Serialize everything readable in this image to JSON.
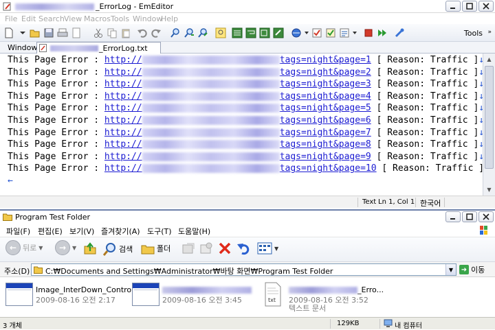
{
  "editor": {
    "title_suffix": "_ErrorLog - EmEditor",
    "menu": [
      "File",
      "Edit",
      "Search",
      "View",
      "Macros",
      "Tools",
      "Window",
      "Help"
    ],
    "tools_label": "Tools",
    "windows_label": "Windows",
    "tab_label": "_ErrorLog.txt",
    "lines": [
      {
        "prefix": "This Page Error : ",
        "url_start": "http://",
        "url_end": "tags=night&page=1",
        "suffix": " [ Reason: Traffic ]",
        "eol": "↓"
      },
      {
        "prefix": "This Page Error : ",
        "url_start": "http://",
        "url_end": "tags=night&page=2",
        "suffix": " [ Reason: Traffic ]",
        "eol": "↓"
      },
      {
        "prefix": "This Page Error : ",
        "url_start": "http://",
        "url_end": "tags=night&page=3",
        "suffix": " [ Reason: Traffic ]",
        "eol": "↓"
      },
      {
        "prefix": "This Page Error : ",
        "url_start": "http://",
        "url_end": "tags=night&page=4",
        "suffix": " [ Reason: Traffic ]",
        "eol": "↓"
      },
      {
        "prefix": "This Page Error : ",
        "url_start": "http://",
        "url_end": "tags=night&page=5",
        "suffix": " [ Reason: Traffic ]",
        "eol": "↓"
      },
      {
        "prefix": "This Page Error : ",
        "url_start": "http://",
        "url_end": "tags=night&page=6",
        "suffix": " [ Reason: Traffic ]",
        "eol": "↓"
      },
      {
        "prefix": "This Page Error : ",
        "url_start": "http://",
        "url_end": "tags=night&page=7",
        "suffix": " [ Reason: Traffic ]",
        "eol": "↓"
      },
      {
        "prefix": "This Page Error : ",
        "url_start": "http://",
        "url_end": "tags=night&page=8",
        "suffix": " [ Reason: Traffic ]",
        "eol": "↓"
      },
      {
        "prefix": "This Page Error : ",
        "url_start": "http://",
        "url_end": "tags=night&page=9",
        "suffix": " [ Reason: Traffic ]",
        "eol": "↓"
      },
      {
        "prefix": "This Page Error : ",
        "url_start": "http://",
        "url_end": "tags=night&page=10",
        "suffix": " [ Reason: Traffic ]",
        "eol": "↓"
      }
    ],
    "eof_mark": "←",
    "status": {
      "mode": "Text",
      "position": "Ln 1, Col 1",
      "ime": "한국어"
    }
  },
  "explorer": {
    "title": "Program Test Folder",
    "menu": [
      "파일(F)",
      "편집(E)",
      "보기(V)",
      "즐겨찾기(A)",
      "도구(T)",
      "도움말(H)"
    ],
    "toolbar": {
      "back": "뒤로",
      "search": "검색",
      "folders": "폴더"
    },
    "address_label": "주소(D)",
    "address_value": "C:₩Documents and Settings₩Administrator₩바탕 화면₩Program Test Folder",
    "go_label": "이동",
    "files": [
      {
        "name": "Image_InterDown_Controler",
        "date": "2009-08-16 오전 2:17",
        "kind": ""
      },
      {
        "name": "",
        "date": "2009-08-16 오전 3:45",
        "kind": ""
      },
      {
        "name": "_Erro...",
        "date": "2009-08-16 오전 3:52",
        "kind": "텍스트 문서"
      }
    ],
    "status": {
      "count": "3 개체",
      "size": "129KB",
      "location": "내 컴퓨터"
    }
  },
  "colors": {
    "url": "#1a1ad2",
    "titlebar_border": "#6b7fa8",
    "go_green": "#3aa54a"
  }
}
